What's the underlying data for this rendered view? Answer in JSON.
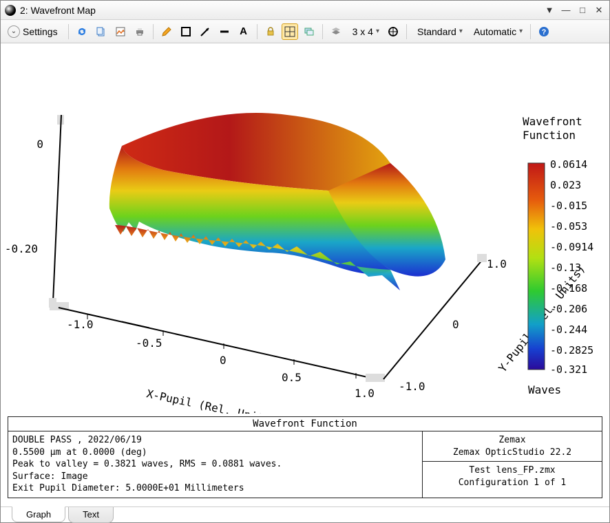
{
  "window": {
    "title": "2: Wavefront Map"
  },
  "toolbar": {
    "settings_label": "Settings",
    "grid_label": "3 x 4",
    "dropdown_standard": "Standard",
    "dropdown_automatic": "Automatic"
  },
  "chart_data": {
    "type": "surface3d",
    "title": "Wavefront Function",
    "xlabel": "X-Pupil (Rel. Units)",
    "ylabel": "Y-Pupil (Rel. Units)",
    "zlabel": "",
    "x_range": [
      -1.0,
      1.0
    ],
    "y_range": [
      -1.0,
      1.0
    ],
    "z_range": [
      -0.321,
      0.0614
    ],
    "x_ticks": [
      "-1.0",
      "-0.5",
      "0",
      "0.5",
      "1.0"
    ],
    "y_ticks": [
      "-1.0",
      "0",
      "1.0"
    ],
    "z_ticks": [
      "0",
      "-0.20"
    ],
    "colormap_label": "Waves",
    "colormap_values": [
      "0.0614",
      "0.023",
      "-0.015",
      "-0.053",
      "-0.0914",
      "-0.13",
      "-0.168",
      "-0.206",
      "-0.244",
      "-0.2825",
      "-0.321"
    ]
  },
  "info": {
    "header": "Wavefront Function",
    "lines": [
      "DOUBLE PASS , 2022/06/19",
      "0.5500 µm at 0.0000 (deg)",
      "Peak to valley = 0.3821 waves, RMS = 0.0881 waves.",
      "Surface: Image",
      "Exit Pupil Diameter: 5.0000E+01 Millimeters"
    ],
    "right1": [
      "Zemax",
      "Zemax OpticStudio 22.2"
    ],
    "right2": [
      "Test lens_FP.zmx",
      "Configuration 1 of 1"
    ]
  },
  "tabs": {
    "graph": "Graph",
    "text": "Text"
  }
}
